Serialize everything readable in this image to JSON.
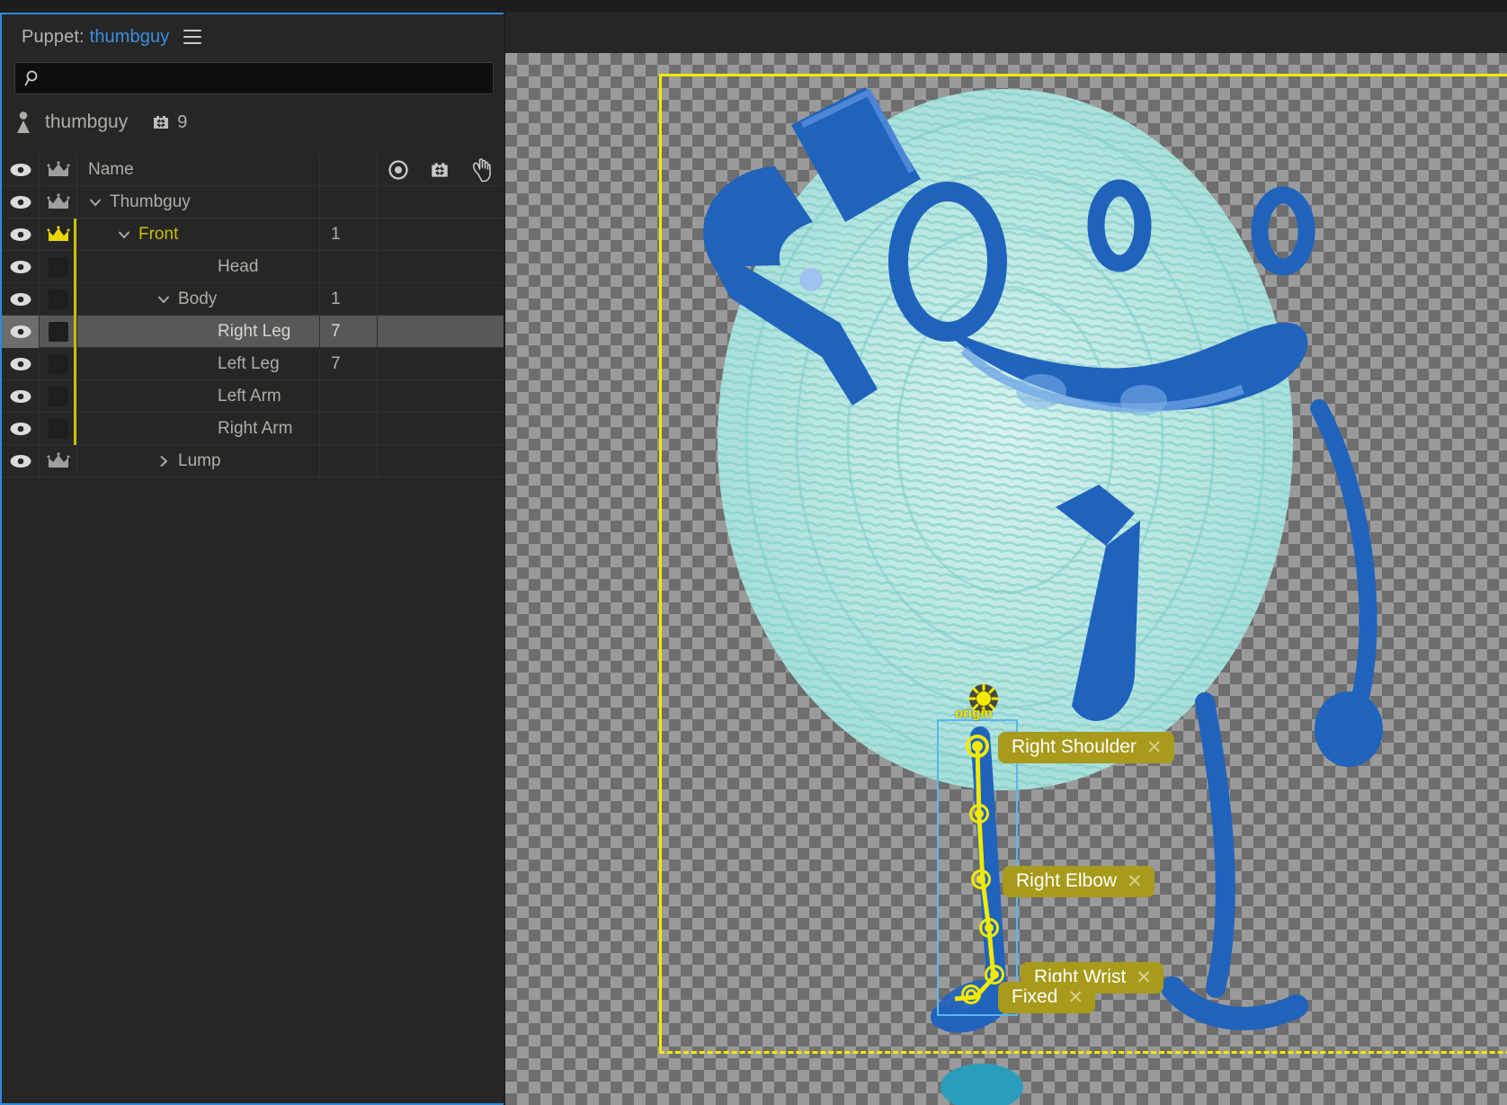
{
  "panel": {
    "title_prefix": "Puppet:",
    "document_name": "thumbguy",
    "menu_icon": "hamburger-icon"
  },
  "search": {
    "value": "",
    "placeholder": "",
    "icon": "search-icon"
  },
  "puppet": {
    "icon": "puppet-person-icon",
    "name": "thumbguy",
    "keyframe_icon": "behavior-gear-icon",
    "keyframe_count": "9"
  },
  "tree": {
    "columns": {
      "visibility": "eye-icon",
      "crown": "crown-icon",
      "name": "Name",
      "record": "record-circle-icon",
      "behavior": "behavior-gear-icon",
      "handle": "hand-pointer-icon"
    },
    "rows": [
      {
        "name": "Thumbguy",
        "indent": 0,
        "chevron": "down",
        "crown": "gray",
        "tag": false,
        "num": "",
        "selected": false,
        "ybar": false
      },
      {
        "name": "Front",
        "indent": 1,
        "chevron": "down",
        "crown": "yellow",
        "tag": false,
        "num": "1",
        "selected": false,
        "ybar": true,
        "accent": "yellow"
      },
      {
        "name": "Head",
        "indent": 3,
        "chevron": "none",
        "crown": "none",
        "tag": true,
        "num": "",
        "selected": false,
        "ybar": true
      },
      {
        "name": "Body",
        "indent": 2,
        "chevron": "down",
        "crown": "none",
        "tag": true,
        "num": "1",
        "selected": false,
        "ybar": true
      },
      {
        "name": "Right Leg",
        "indent": 3,
        "chevron": "none",
        "crown": "none",
        "tag": true,
        "num": "7",
        "selected": true,
        "ybar": true
      },
      {
        "name": "Left Leg",
        "indent": 3,
        "chevron": "none",
        "crown": "none",
        "tag": true,
        "num": "7",
        "selected": false,
        "ybar": true
      },
      {
        "name": "Left Arm",
        "indent": 3,
        "chevron": "none",
        "crown": "none",
        "tag": true,
        "num": "",
        "selected": false,
        "ybar": true
      },
      {
        "name": "Right Arm",
        "indent": 3,
        "chevron": "none",
        "crown": "none",
        "tag": true,
        "num": "",
        "selected": false,
        "ybar": true
      },
      {
        "name": "Lump",
        "indent": 2,
        "chevron": "right",
        "crown": "gray",
        "tag": false,
        "num": "",
        "selected": false,
        "ybar": false
      }
    ]
  },
  "stage": {
    "origin_label": "origin",
    "origin_icon": "sun-origin-icon",
    "bounds_color": "#f2ea00",
    "selection_color": "#5bb7ea",
    "pin_color": "#f2ea00",
    "badge_color": "#a89a1a",
    "pins": [
      {
        "label": "Right Shoulder",
        "close": "✕"
      },
      {
        "label": "Right Elbow",
        "close": "✕"
      },
      {
        "label": "Right Wrist",
        "close": "✕"
      },
      {
        "label": "Fixed",
        "close": "✕"
      }
    ]
  }
}
